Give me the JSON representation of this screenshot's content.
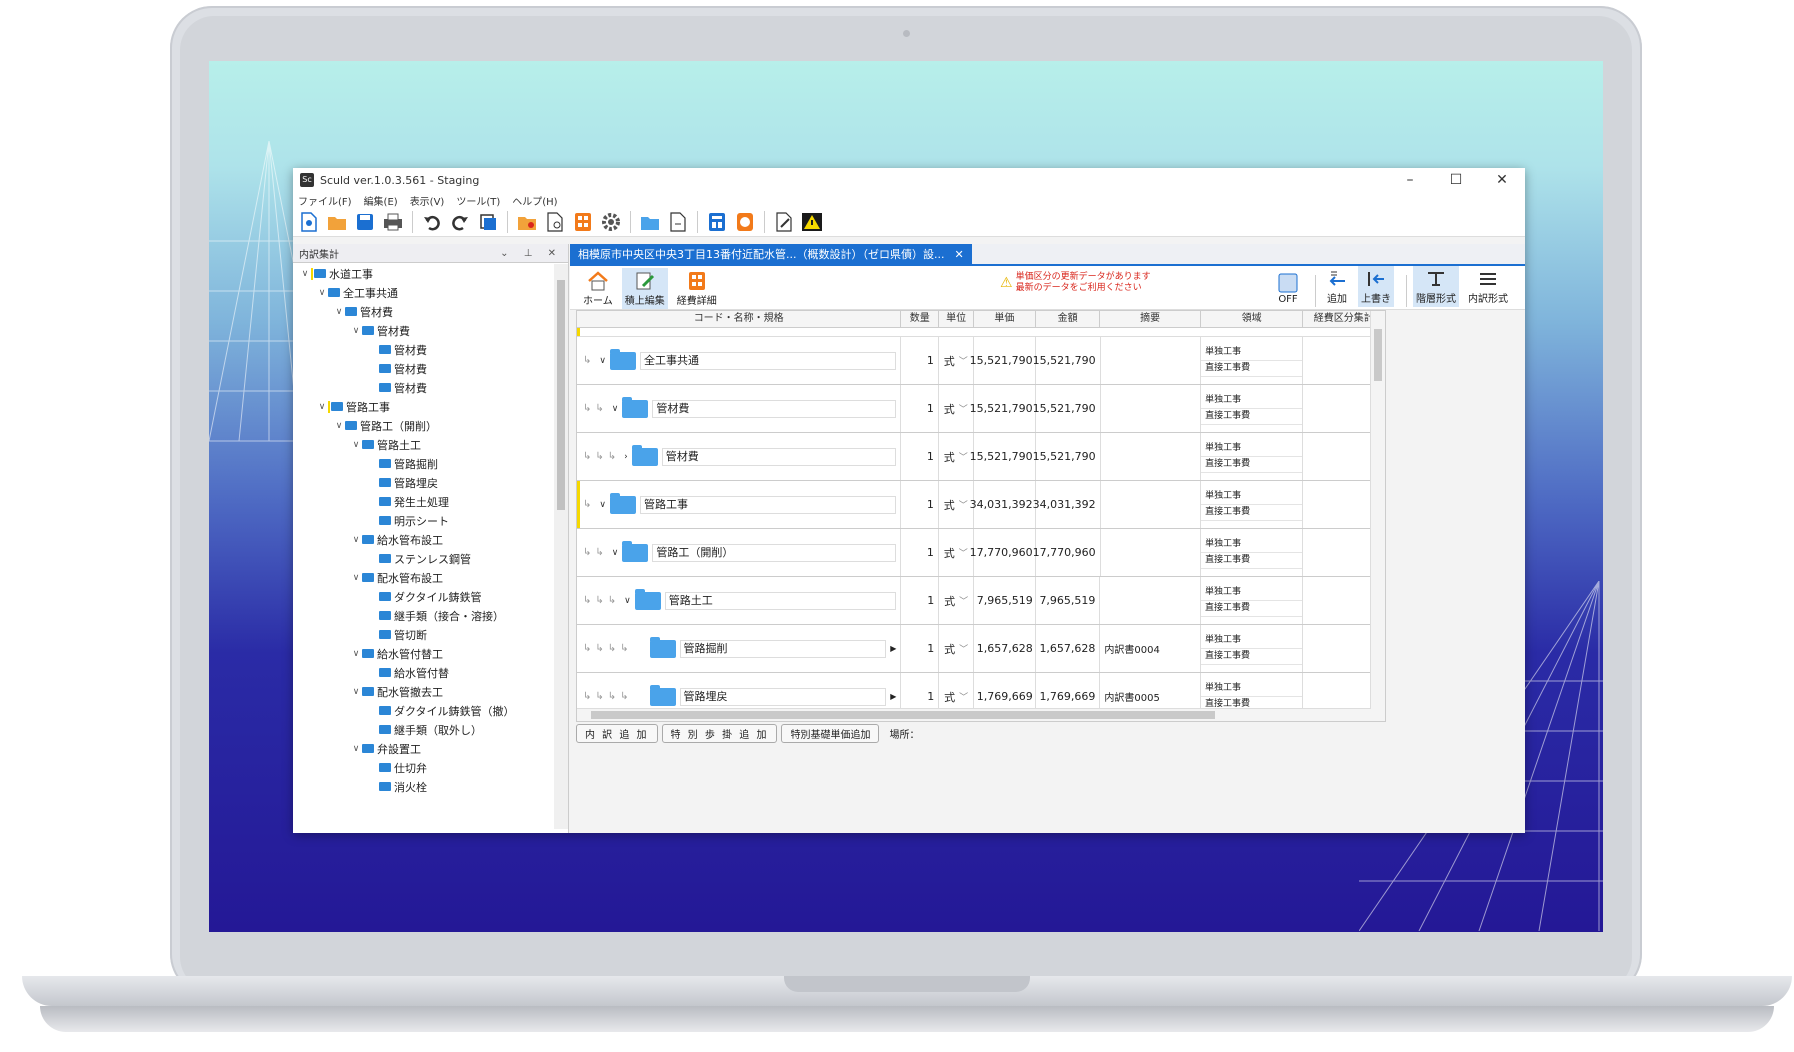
{
  "window": {
    "title": "Sculd ver.1.0.3.561 - Staging",
    "logo": "Sc",
    "controls": [
      "–",
      "☐",
      "✕"
    ]
  },
  "menu": [
    "ファイル(F)",
    "編集(E)",
    "表示(V)",
    "ツール(T)",
    "ヘルプ(H)"
  ],
  "left_pane": {
    "title": "内訳集計",
    "tree": [
      {
        "label": "水道工事",
        "level": 0,
        "expanded": true,
        "marked": true
      },
      {
        "label": "全工事共通",
        "level": 1,
        "expanded": true
      },
      {
        "label": "管材費",
        "level": 2,
        "expanded": true
      },
      {
        "label": "管材費",
        "level": 3,
        "expanded": true
      },
      {
        "label": "管材費",
        "level": 4
      },
      {
        "label": "管材費",
        "level": 4
      },
      {
        "label": "管材費",
        "level": 4
      },
      {
        "label": "管路工事",
        "level": 1,
        "expanded": true,
        "marked": true
      },
      {
        "label": "管路工（開削）",
        "level": 2,
        "expanded": true
      },
      {
        "label": "管路土工",
        "level": 3,
        "expanded": true
      },
      {
        "label": "管路掘削",
        "level": 4
      },
      {
        "label": "管路埋戻",
        "level": 4
      },
      {
        "label": "発生土処理",
        "level": 4
      },
      {
        "label": "明示シート",
        "level": 4
      },
      {
        "label": "給水管布設工",
        "level": 3,
        "expanded": true
      },
      {
        "label": "ステンレス鋼管",
        "level": 4
      },
      {
        "label": "配水管布設工",
        "level": 3,
        "expanded": true
      },
      {
        "label": "ダクタイル鋳鉄管",
        "level": 4
      },
      {
        "label": "継手類（接合・溶接）",
        "level": 4
      },
      {
        "label": "管切断",
        "level": 4
      },
      {
        "label": "給水管付替工",
        "level": 3,
        "expanded": true
      },
      {
        "label": "給水管付替",
        "level": 4
      },
      {
        "label": "配水管撤去工",
        "level": 3,
        "expanded": true
      },
      {
        "label": "ダクタイル鋳鉄管（撤）",
        "level": 4
      },
      {
        "label": "継手類（取外し）",
        "level": 4
      },
      {
        "label": "弁設置工",
        "level": 3,
        "expanded": true
      },
      {
        "label": "仕切弁",
        "level": 4
      },
      {
        "label": "消火栓",
        "level": 4
      }
    ]
  },
  "tab": {
    "label": "相模原市中央区中央3丁目13番付近配水管...（概数設計）（ゼロ県債）設...",
    "close": "✕"
  },
  "ribbon": {
    "home": "ホーム",
    "edit": "積上編集",
    "detail": "経費詳細",
    "warning_line1": "単価区分の更新データがあります",
    "warning_line2": "最新のデータをご利用ください",
    "off": "OFF",
    "add": "追加",
    "overwrite": "上書き",
    "hierarchy": "階層形式",
    "breakdown": "内訳形式"
  },
  "grid": {
    "headers": [
      "コード・名称・規格",
      "数量",
      "単位",
      "単価",
      "金額",
      "摘要",
      "領域",
      "経費区分集計"
    ],
    "rows": [
      {
        "name": "全工事共通",
        "depth": 1,
        "chev": "∨",
        "qty": "1",
        "unit": "式",
        "price": "15,521,790",
        "amount": "15,521,790",
        "note": "",
        "area1": "単独工事",
        "area2": "直接工事費",
        "flag": false,
        "more": false
      },
      {
        "name": "管材費",
        "depth": 2,
        "chev": "∨",
        "qty": "1",
        "unit": "式",
        "price": "15,521,790",
        "amount": "15,521,790",
        "note": "",
        "area1": "単独工事",
        "area2": "直接工事費",
        "flag": false,
        "more": false
      },
      {
        "name": "管材費",
        "depth": 3,
        "chev": "›",
        "qty": "1",
        "unit": "式",
        "price": "15,521,790",
        "amount": "15,521,790",
        "note": "",
        "area1": "単独工事",
        "area2": "直接工事費",
        "flag": false,
        "more": false
      },
      {
        "name": "管路工事",
        "depth": 1,
        "chev": "∨",
        "qty": "1",
        "unit": "式",
        "price": "34,031,392",
        "amount": "34,031,392",
        "note": "",
        "area1": "単独工事",
        "area2": "直接工事費",
        "flag": true,
        "more": false
      },
      {
        "name": "管路工（開削）",
        "depth": 2,
        "chev": "∨",
        "qty": "1",
        "unit": "式",
        "price": "17,770,960",
        "amount": "17,770,960",
        "note": "",
        "area1": "単独工事",
        "area2": "直接工事費",
        "flag": false,
        "more": false
      },
      {
        "name": "管路土工",
        "depth": 3,
        "chev": "∨",
        "qty": "1",
        "unit": "式",
        "price": "7,965,519",
        "amount": "7,965,519",
        "note": "",
        "area1": "単独工事",
        "area2": "直接工事費",
        "flag": false,
        "more": false
      },
      {
        "name": "管路掘削",
        "depth": 4,
        "chev": "",
        "qty": "1",
        "unit": "式",
        "price": "1,657,628",
        "amount": "1,657,628",
        "note": "内訳書0004",
        "area1": "単独工事",
        "area2": "直接工事費",
        "flag": false,
        "more": true
      },
      {
        "name": "管路埋戻",
        "depth": 4,
        "chev": "",
        "qty": "1",
        "unit": "式",
        "price": "1,769,669",
        "amount": "1,769,669",
        "note": "内訳書0005",
        "area1": "単独工事",
        "area2": "直接工事費",
        "flag": false,
        "more": true
      }
    ]
  },
  "bottom": {
    "btn1": "内 訳 追 加",
    "btn2": "特 別 歩 掛 追 加",
    "btn3": "特別基礎単価追加",
    "place_label": "場所："
  }
}
